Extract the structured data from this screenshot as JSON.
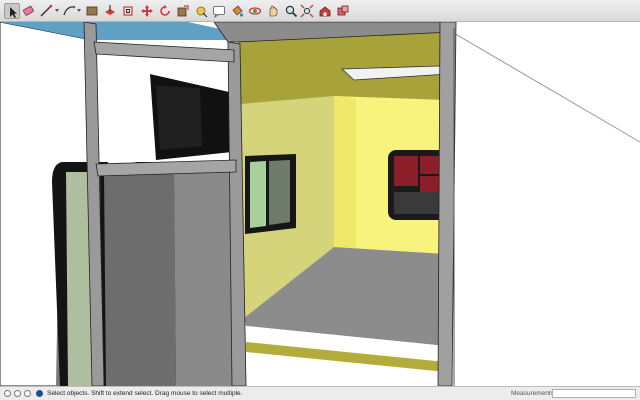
{
  "toolbar": {
    "tools": [
      {
        "name": "select-tool-icon",
        "active": true
      },
      {
        "name": "eraser-tool-icon"
      },
      {
        "name": "line-tool-icon"
      },
      {
        "name": "arc-tool-icon"
      },
      {
        "name": "rectangle-tool-icon"
      },
      {
        "name": "push-pull-tool-icon"
      },
      {
        "name": "offset-tool-icon"
      },
      {
        "name": "move-tool-icon"
      },
      {
        "name": "rotate-tool-icon"
      },
      {
        "name": "scale-tool-icon"
      },
      {
        "name": "tape-measure-tool-icon"
      },
      {
        "name": "text-tool-icon"
      },
      {
        "name": "paint-bucket-tool-icon"
      },
      {
        "name": "orbit-tool-icon"
      },
      {
        "name": "pan-tool-icon"
      },
      {
        "name": "zoom-tool-icon"
      },
      {
        "name": "zoom-extents-tool-icon"
      },
      {
        "name": "warehouse-tool-icon"
      },
      {
        "name": "extensions-tool-icon"
      }
    ],
    "accent_color": "#d03a3a"
  },
  "status": {
    "hint": "Select objects. Shift to extend select. Drag mouse to select multiple.",
    "measurements_label": "Measurements",
    "measurements_value": ""
  }
}
